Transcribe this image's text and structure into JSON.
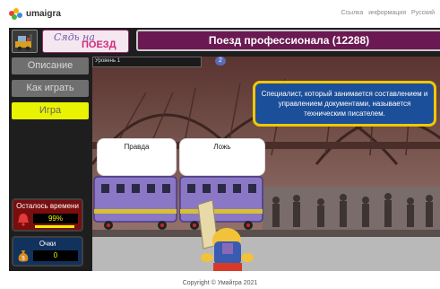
{
  "site": {
    "logo_text": "umaigra",
    "nav": [
      "Ссылка",
      "информация",
      "Русский"
    ],
    "footer": "Copyright © Умайгра 2021"
  },
  "game": {
    "brand_top": "Сядь на",
    "brand_bottom": "ПОЕЗД",
    "title": "Поезд профессионала (12288)",
    "menu": {
      "description": "Описание",
      "how_to_play": "Как играть",
      "play": "Игра"
    },
    "time_panel": {
      "label": "Осталось времени",
      "value": "99%",
      "fraction": 0.99
    },
    "score_panel": {
      "label": "Очки",
      "value": "0"
    },
    "level": {
      "label": "Уровень 1",
      "badge": "2"
    },
    "question": "Специалист, который занимается составлением и управлением документами, называется техническим писателем.",
    "answers": {
      "true_label": "Правда",
      "false_label": "Ложь"
    },
    "colors": {
      "title_bar": "#6b1952",
      "active_menu": "#e9f200",
      "speech_bubble": "#1c4f9a",
      "speech_border": "#f0c800"
    },
    "icons": [
      "train-icon",
      "alarm-bell-icon",
      "money-bag-icon",
      "speaker-icon"
    ]
  }
}
